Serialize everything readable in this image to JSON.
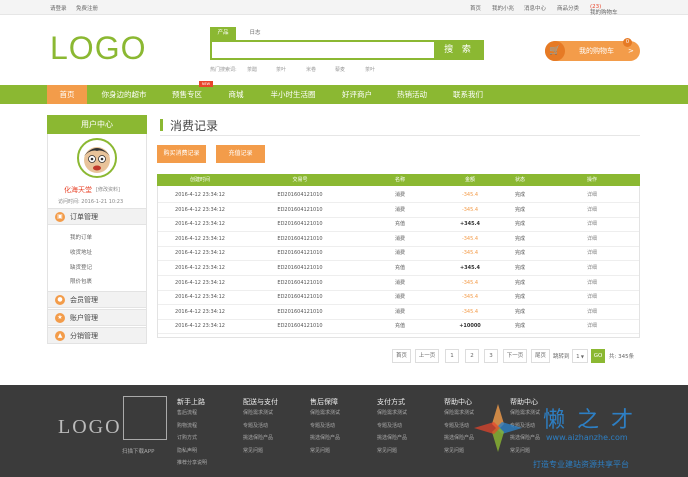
{
  "topbar": {
    "login": "请登录",
    "register": "免费注册",
    "links": [
      "首页",
      "我的小兆",
      "消息中心",
      "商品分类"
    ],
    "cart_label": "我的购物车",
    "cart_count": "(23)"
  },
  "header": {
    "logo": "LOGO",
    "search_tabs": [
      "产品",
      "日志"
    ],
    "search_button": "搜 索",
    "hot_label": "热门搜索词:",
    "hot_words": [
      "茶醋",
      "茶叶",
      "米卷",
      "藜麦",
      "茶叶"
    ],
    "cart_button": "我的购物车",
    "cart_arrow": ">",
    "cart_badge": "0"
  },
  "nav": {
    "items": [
      "首页",
      "你身边的超市",
      "预售专区",
      "商城",
      "半小时生活圈",
      "好评商户",
      "热销活动",
      "联系我们"
    ],
    "badge": "NEW"
  },
  "sidebar": {
    "title": "用户中心",
    "username": "化海天堂",
    "edit": "[修改资料]",
    "last_visit": "访问时间: 2016-1-21 10:23",
    "sections": [
      {
        "label": "订单管理",
        "items": [
          "我的订单",
          "收货地址",
          "缺货登记",
          "限价包裹"
        ]
      },
      {
        "label": "会员管理"
      },
      {
        "label": "账户管理"
      },
      {
        "label": "分销管理"
      }
    ]
  },
  "main": {
    "title": "消费记录",
    "buttons": [
      "购买消费记录",
      "充值记录"
    ],
    "columns": [
      "创建时间",
      "交易号",
      "名称",
      "金额",
      "状态",
      "操作"
    ],
    "rows": [
      {
        "time": "2016-4-12 23:34:12",
        "no": "ED201604121010",
        "name": "消费",
        "amount": "-345.4",
        "status": "完成",
        "op": "详细"
      },
      {
        "time": "2016-4-12 23:34:12",
        "no": "ED201604121010",
        "name": "消费",
        "amount": "-345.4",
        "status": "完成",
        "op": "详细"
      },
      {
        "time": "2016-4-12 23:34:12",
        "no": "ED201604121010",
        "name": "充值",
        "amount": "+345.4",
        "status": "完成",
        "op": "详细"
      },
      {
        "time": "2016-4-12 23:34:12",
        "no": "ED201604121010",
        "name": "消费",
        "amount": "-345.4",
        "status": "完成",
        "op": "详细"
      },
      {
        "time": "2016-4-12 23:34:12",
        "no": "ED201604121010",
        "name": "消费",
        "amount": "-345.4",
        "status": "完成",
        "op": "详细"
      },
      {
        "time": "2016-4-12 23:34:12",
        "no": "ED201604121010",
        "name": "充值",
        "amount": "+345.4",
        "status": "完成",
        "op": "详细"
      },
      {
        "time": "2016-4-12 23:34:12",
        "no": "ED201604121010",
        "name": "消费",
        "amount": "-345.4",
        "status": "完成",
        "op": "详细"
      },
      {
        "time": "2016-4-12 23:34:12",
        "no": "ED201604121010",
        "name": "消费",
        "amount": "-345.4",
        "status": "完成",
        "op": "详细"
      },
      {
        "time": "2016-4-12 23:34:12",
        "no": "ED201604121010",
        "name": "消费",
        "amount": "-345.4",
        "status": "完成",
        "op": "详细"
      },
      {
        "time": "2016-4-12 23:34:12",
        "no": "ED201604121010",
        "name": "充值",
        "amount": "+10000",
        "status": "完成",
        "op": "详细"
      }
    ],
    "pagination": {
      "first": "首页",
      "prev": "上一页",
      "pages": [
        "1",
        "2",
        "3"
      ],
      "next": "下一页",
      "last": "尾页",
      "jump_label": "跳转到",
      "jump_value": "1",
      "go": "GO",
      "total": "共: 345条"
    }
  },
  "footer": {
    "logo": "LOGO",
    "app_label": "扫描下载APP",
    "columns": [
      {
        "title": "新手上路",
        "links": [
          "售后流程",
          "购物流程",
          "订购方式",
          "隐私声明",
          "推荐分享说明"
        ]
      },
      {
        "title": "配送与支付",
        "links": [
          "保险需求测试",
          "专题及活动",
          "挑选保险产品",
          "常见问题"
        ]
      },
      {
        "title": "售后保障",
        "links": [
          "保险需求测试",
          "专题及活动",
          "挑选保险产品",
          "常见问题"
        ]
      },
      {
        "title": "支付方式",
        "links": [
          "保险需求测试",
          "专题及活动",
          "挑选保险产品",
          "常见问题"
        ]
      },
      {
        "title": "帮助中心",
        "links": [
          "保险需求测试",
          "专题及活动",
          "挑选保险产品",
          "常见问题"
        ]
      },
      {
        "title": "帮助中心",
        "links": [
          "保险需求测试",
          "专题及活动",
          "挑选保险产品",
          "常见问题"
        ]
      }
    ]
  },
  "watermark": {
    "text": "懒之才",
    "url": "www.aizhanzhe.com",
    "slogan": "打造专业建站资源共享平台"
  },
  "colors": {
    "green": "#8bb832",
    "orange": "#f39c4a",
    "footer": "#3b3b3b",
    "negative": "#f39c4a"
  }
}
